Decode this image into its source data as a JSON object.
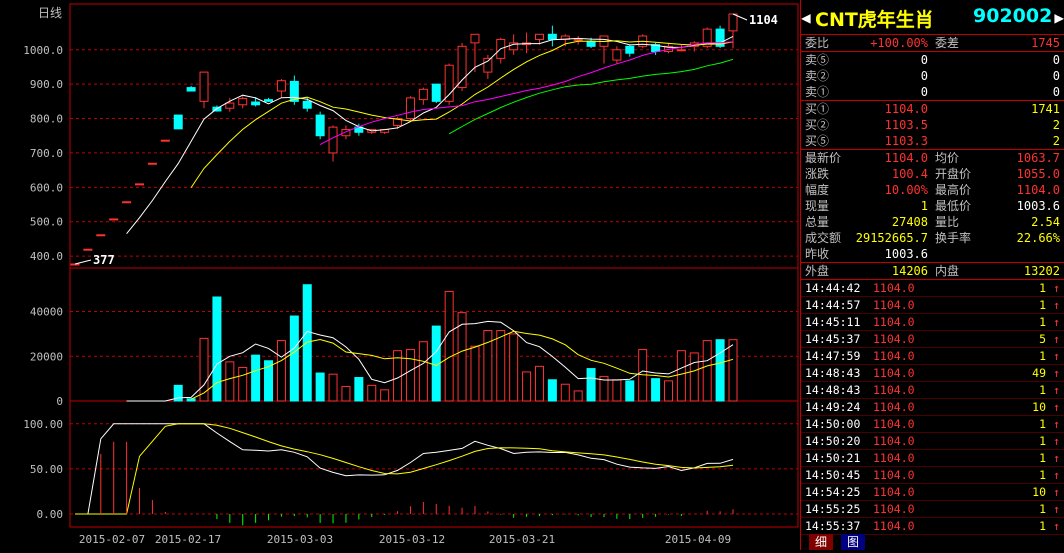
{
  "chart": {
    "period_label": "日线",
    "price_axis": [
      "1000.0",
      "900.0",
      "800.0",
      "700.0",
      "600.0",
      "500.0",
      "400.0"
    ],
    "volume_axis": [
      "40000",
      "20000",
      "0"
    ],
    "indicator_axis": [
      "100.00",
      "50.00",
      "0.00"
    ],
    "date_labels": [
      "2015-02-07",
      "2015-02-17",
      "2015-03-03",
      "2015-03-12",
      "2015-03-21",
      "2015-04-09"
    ],
    "high_marker": "1104",
    "low_marker": "377",
    "colors": {
      "up": "#ff3232",
      "down": "#00ffff",
      "ma5": "#ffffff",
      "ma10": "#ffff00",
      "ma20": "#ff00ff",
      "ma30": "#00ff00",
      "grid": "#c00000"
    }
  },
  "header": {
    "stock_name": "CNT虎年生肖",
    "stock_code": "902002",
    "arrow_left": "◀",
    "arrow_right": "▶"
  },
  "order": {
    "weibi_label": "委比",
    "weibi": "+100.00%",
    "weicha_label": "委差",
    "weicha": "1745",
    "sells": [
      {
        "label": "卖⑤",
        "price": "0",
        "vol": "0"
      },
      {
        "label": "卖②",
        "price": "0",
        "vol": "0"
      },
      {
        "label": "卖①",
        "price": "0",
        "vol": "0"
      }
    ],
    "buys": [
      {
        "label": "买①",
        "price": "1104.0",
        "vol": "1741"
      },
      {
        "label": "买②",
        "price": "1103.5",
        "vol": "2"
      },
      {
        "label": "买⑤",
        "price": "1103.3",
        "vol": "2"
      }
    ]
  },
  "quote": {
    "latest_label": "最新价",
    "latest": "1104.0",
    "avg_label": "均价",
    "avg": "1063.7",
    "change_label": "涨跌",
    "change": "100.4",
    "open_label": "开盘价",
    "open": "1055.0",
    "pct_label": "幅度",
    "pct": "10.00%",
    "high_label": "最高价",
    "high": "1104.0",
    "cur_label": "现量",
    "cur": "1",
    "low_label": "最低价",
    "low": "1003.6",
    "total_label": "总量",
    "total": "27408",
    "ratio_label": "量比",
    "ratio": "2.54",
    "amount_label": "成交额",
    "amount": "29152665.7",
    "turn_label": "换手率",
    "turn": "22.66%",
    "prev_label": "昨收",
    "prev": "1003.6",
    "outer_label": "外盘",
    "outer": "14206",
    "inner_label": "内盘",
    "inner": "13202"
  },
  "ticks": [
    {
      "time": "14:44:42",
      "price": "1104.0",
      "vol": "1"
    },
    {
      "time": "14:44:57",
      "price": "1104.0",
      "vol": "1"
    },
    {
      "time": "14:45:11",
      "price": "1104.0",
      "vol": "1"
    },
    {
      "time": "14:45:37",
      "price": "1104.0",
      "vol": "5"
    },
    {
      "time": "14:47:59",
      "price": "1104.0",
      "vol": "1"
    },
    {
      "time": "14:48:43",
      "price": "1104.0",
      "vol": "49"
    },
    {
      "time": "14:48:43",
      "price": "1104.0",
      "vol": "1"
    },
    {
      "time": "14:49:24",
      "price": "1104.0",
      "vol": "10"
    },
    {
      "time": "14:50:00",
      "price": "1104.0",
      "vol": "1"
    },
    {
      "time": "14:50:20",
      "price": "1104.0",
      "vol": "1"
    },
    {
      "time": "14:50:21",
      "price": "1104.0",
      "vol": "1"
    },
    {
      "time": "14:50:45",
      "price": "1104.0",
      "vol": "1"
    },
    {
      "time": "14:54:25",
      "price": "1104.0",
      "vol": "10"
    },
    {
      "time": "14:55:25",
      "price": "1104.0",
      "vol": "1"
    },
    {
      "time": "14:55:37",
      "price": "1104.0",
      "vol": "1"
    }
  ],
  "tick_arrow": "↑",
  "tabs": {
    "detail": "细",
    "chart": "图"
  },
  "chart_data": {
    "type": "candlestick",
    "candles": [
      [
        377,
        377,
        377,
        377
      ],
      [
        420,
        420,
        420,
        420
      ],
      [
        462,
        462,
        462,
        462
      ],
      [
        508,
        508,
        508,
        508
      ],
      [
        558,
        558,
        558,
        558
      ],
      [
        610,
        610,
        610,
        610
      ],
      [
        670,
        670,
        670,
        670
      ],
      [
        737,
        737,
        737,
        737
      ],
      [
        810,
        770,
        810,
        770
      ],
      [
        890,
        880,
        895,
        880
      ],
      [
        850,
        935,
        830,
        935
      ],
      [
        833,
        822,
        820,
        838
      ],
      [
        830,
        845,
        820,
        860
      ],
      [
        840,
        858,
        830,
        865
      ],
      [
        848,
        840,
        835,
        862
      ],
      [
        855,
        850,
        848,
        860
      ],
      [
        880,
        910,
        860,
        915
      ],
      [
        908,
        850,
        840,
        925
      ],
      [
        850,
        830,
        820,
        860
      ],
      [
        810,
        750,
        740,
        820
      ],
      [
        700,
        775,
        675,
        780
      ],
      [
        750,
        768,
        740,
        780
      ],
      [
        775,
        760,
        750,
        785
      ],
      [
        760,
        768,
        755,
        770
      ],
      [
        760,
        768,
        755,
        770
      ],
      [
        780,
        800,
        770,
        805
      ],
      [
        800,
        860,
        795,
        865
      ],
      [
        855,
        885,
        840,
        890
      ],
      [
        900,
        850,
        845,
        900
      ],
      [
        850,
        955,
        840,
        960
      ],
      [
        890,
        1010,
        880,
        1020
      ],
      [
        1020,
        1045,
        935,
        1045
      ],
      [
        935,
        975,
        915,
        985
      ],
      [
        975,
        1030,
        960,
        1035
      ],
      [
        1000,
        1020,
        985,
        1045
      ],
      [
        1015,
        1020,
        990,
        1050
      ],
      [
        1030,
        1045,
        1015,
        1045
      ],
      [
        1045,
        1030,
        1010,
        1070
      ],
      [
        1030,
        1040,
        1010,
        1045
      ],
      [
        1030,
        1030,
        1015,
        1040
      ],
      [
        1025,
        1010,
        1005,
        1035
      ],
      [
        1010,
        1040,
        960,
        1040
      ],
      [
        970,
        1000,
        960,
        1010
      ],
      [
        1010,
        990,
        980,
        1015
      ],
      [
        1010,
        1040,
        1005,
        1045
      ],
      [
        1015,
        995,
        985,
        1020
      ],
      [
        995,
        1010,
        990,
        1020
      ],
      [
        1000,
        1000,
        995,
        1015
      ],
      [
        1010,
        1020,
        995,
        1025
      ],
      [
        1010,
        1060,
        1005,
        1065
      ],
      [
        1060,
        1010,
        1005,
        1070
      ],
      [
        1055,
        1104,
        1004,
        1104
      ]
    ],
    "volume": [
      0,
      0,
      0,
      0,
      0,
      0,
      0,
      0,
      7000,
      1000,
      28000,
      46500,
      17500,
      15000,
      20500,
      18000,
      27000,
      38000,
      52000,
      12500,
      12000,
      6500,
      10500,
      7000,
      5000,
      22500,
      23000,
      26500,
      33500,
      49000,
      39500,
      24500,
      31500,
      31500,
      30000,
      13000,
      15500,
      9500,
      7500,
      4500,
      14500,
      11000,
      9500,
      9000,
      23000,
      10000,
      9000,
      22500,
      21500,
      27000,
      27408,
      27408
    ],
    "ylim_price": [
      377,
      1104
    ],
    "ylim_volume": [
      0,
      55000
    ],
    "ylim_indicator": [
      0,
      100
    ],
    "x_labels": [
      "2015-02-07",
      "2015-02-17",
      "2015-03-03",
      "2015-03-12",
      "2015-03-21",
      "2015-04-09"
    ]
  }
}
